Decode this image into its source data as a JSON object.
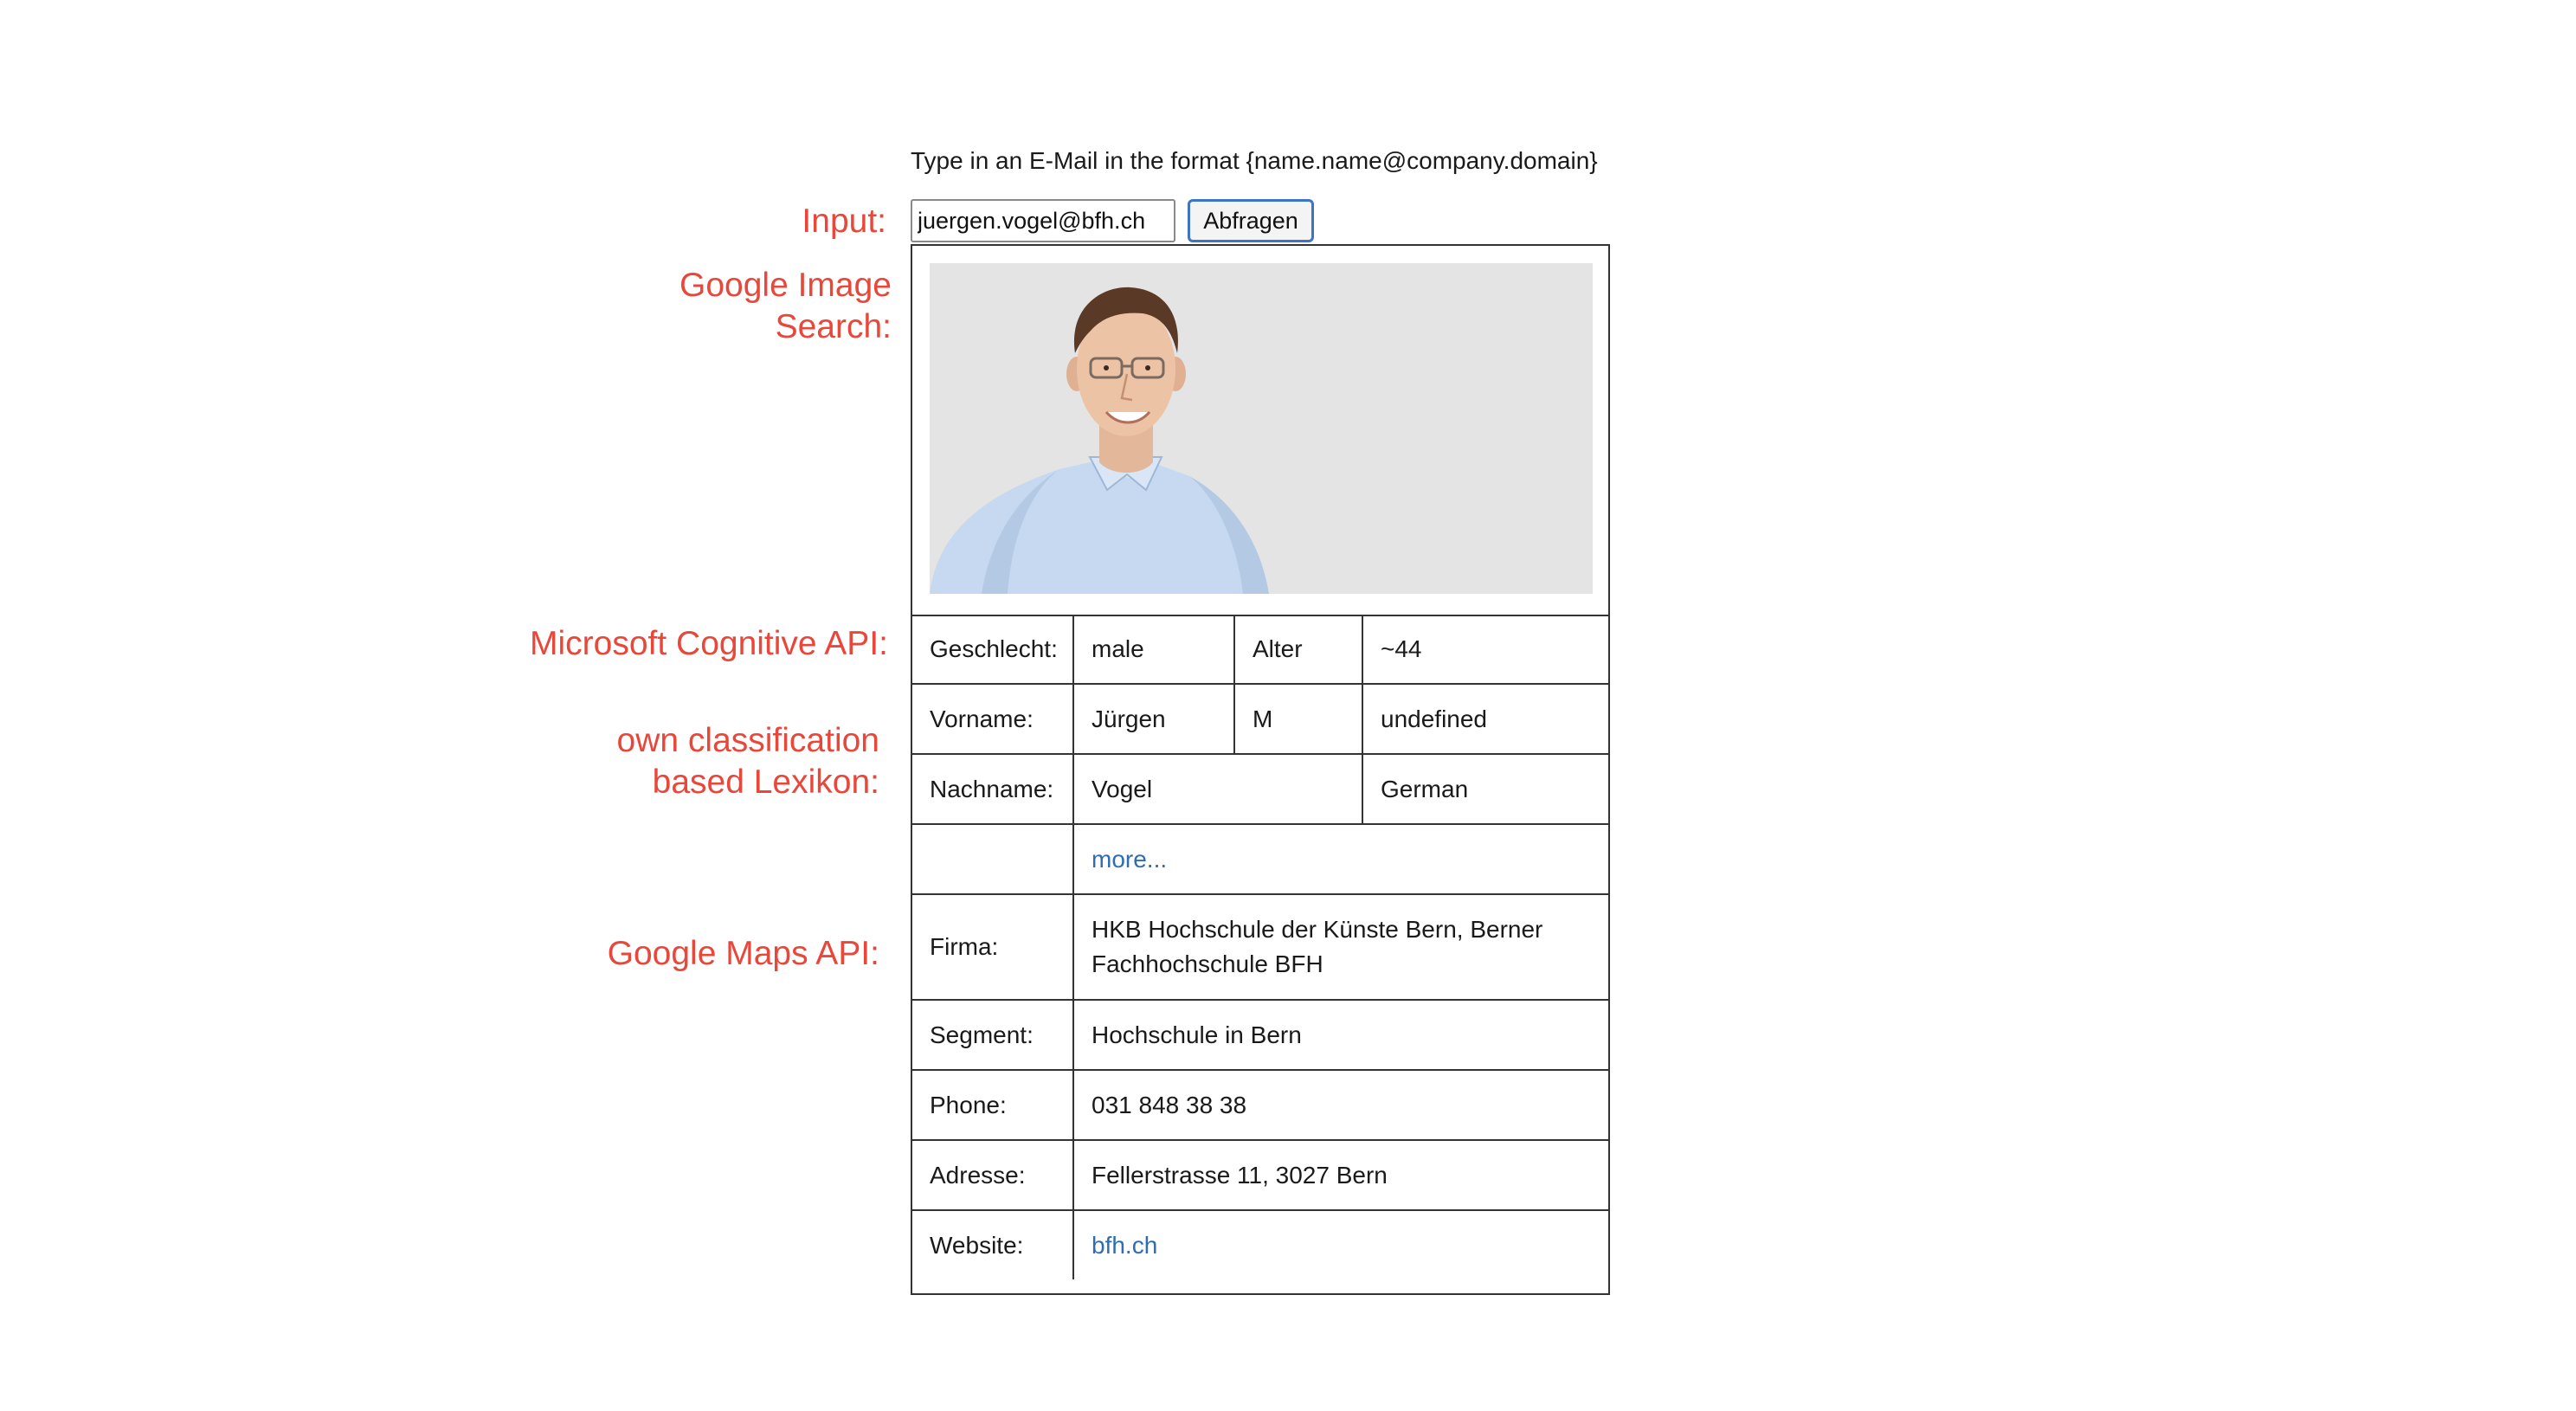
{
  "instruction": "Type in an E-Mail in the format {name.name@company.domain}",
  "annotations": {
    "input": "Input:",
    "google_image_search_line1": "Google Image",
    "google_image_search_line2": "Search:",
    "microsoft_api": "Microsoft Cognitive API:",
    "own_classification_line1": "own classification",
    "own_classification_line2": "based Lexikon:",
    "google_maps": "Google Maps API:"
  },
  "form": {
    "email_value": "juergen.vogel@bfh.ch",
    "button_label": "Abfragen"
  },
  "photo": {
    "icon": "person-photo",
    "background": "#e4e4e4"
  },
  "face": {
    "gender_label": "Geschlecht:",
    "gender_value": "male",
    "age_label": "Alter",
    "age_value": "~44"
  },
  "lexikon": {
    "firstname_label": "Vorname:",
    "firstname_value": "Jürgen",
    "firstname_gender": "M",
    "firstname_origin": "undefined",
    "lastname_label": "Nachname:",
    "lastname_value": "Vogel",
    "lastname_origin": "German",
    "more_link": "more..."
  },
  "maps": {
    "company_label": "Firma:",
    "company_value": "HKB Hochschule der Künste Bern, Berner Fachhochschule BFH",
    "segment_label": "Segment:",
    "segment_value": "Hochschule in Bern",
    "phone_label": "Phone:",
    "phone_value": "031 848 38 38",
    "address_label": "Adresse:",
    "address_value": "Fellerstrasse 11, 3027 Bern",
    "website_label": "Website:",
    "website_value": "bfh.ch"
  },
  "colors": {
    "annotation": "#e8473a",
    "link": "#2f6db3",
    "button_border": "#3d74c7"
  }
}
